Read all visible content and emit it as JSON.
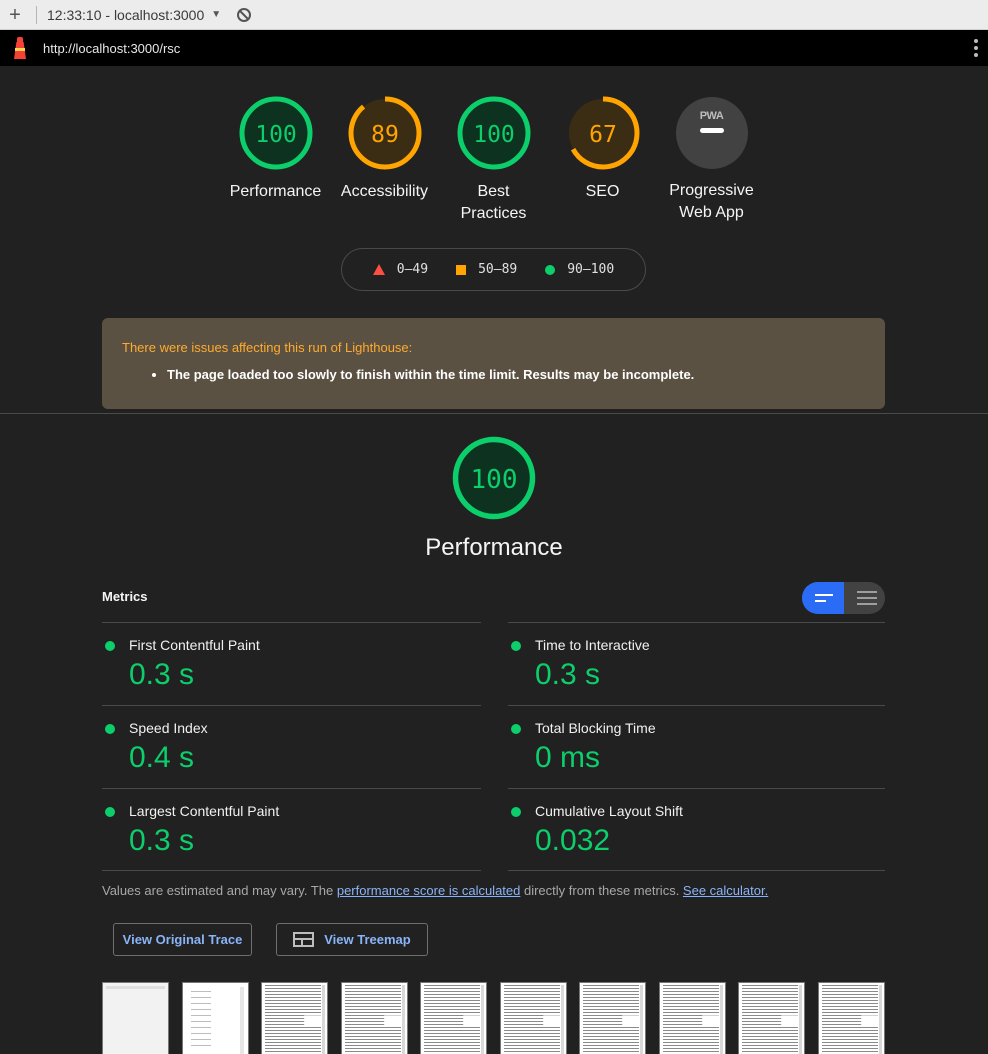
{
  "browser": {
    "tab_title": "12:33:10 - localhost:3000",
    "url": "http://localhost:3000/rsc"
  },
  "gauges": [
    {
      "label": "Performance",
      "score": 100,
      "color": "#0cce6b",
      "fill": "#0d3320"
    },
    {
      "label": "Accessibility",
      "score": 89,
      "color": "#ffa400",
      "fill": "#3b2c14"
    },
    {
      "label": "Best Practices",
      "score": 100,
      "color": "#0cce6b",
      "fill": "#0d3320"
    },
    {
      "label": "SEO",
      "score": 67,
      "color": "#ffa400",
      "fill": "#3b2c14"
    }
  ],
  "pwa": {
    "badge_text": "PWA",
    "label": "Progressive Web App"
  },
  "legend": [
    {
      "shape": "triangle",
      "range": "0–49",
      "color": "#ff4e42"
    },
    {
      "shape": "square",
      "range": "50–89",
      "color": "#ffa400"
    },
    {
      "shape": "circle",
      "range": "90–100",
      "color": "#0cce6b"
    }
  ],
  "warning": {
    "title": "There were issues affecting this run of Lighthouse:",
    "items": [
      "The page loaded too slowly to finish within the time limit. Results may be incomplete."
    ]
  },
  "performance": {
    "score": 100,
    "title": "Performance",
    "metrics_heading": "Metrics",
    "metrics": [
      {
        "name": "First Contentful Paint",
        "value": "0.3 s"
      },
      {
        "name": "Time to Interactive",
        "value": "0.3 s"
      },
      {
        "name": "Speed Index",
        "value": "0.4 s"
      },
      {
        "name": "Total Blocking Time",
        "value": "0 ms"
      },
      {
        "name": "Largest Contentful Paint",
        "value": "0.3 s"
      },
      {
        "name": "Cumulative Layout Shift",
        "value": "0.032"
      }
    ],
    "note_prefix": "Values are estimated and may vary. The ",
    "note_link1": "performance score is calculated",
    "note_middle": " directly from these metrics. ",
    "note_link2": "See calculator.",
    "buttons": {
      "trace": "View Original Trace",
      "treemap": "View Treemap"
    }
  },
  "colors": {
    "pass": "#0cce6b",
    "average": "#ffa400",
    "fail": "#ff4e42",
    "link": "#8ab4f8",
    "toggle_active": "#2a6cf6"
  }
}
